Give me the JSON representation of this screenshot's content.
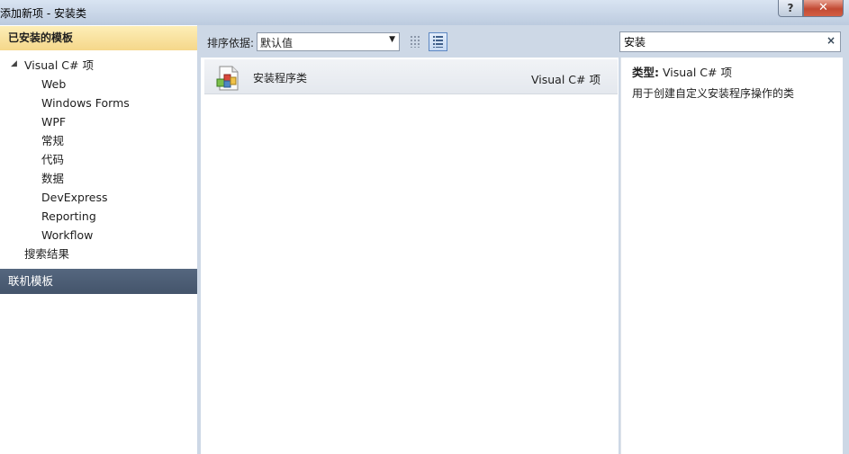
{
  "window": {
    "title": "添加新项 - 安装类",
    "help_label": "?",
    "close_label": "✕"
  },
  "left": {
    "installed_header": "已安装的模板",
    "tree": {
      "root_label": "Visual C# 项",
      "children": [
        "Web",
        "Windows Forms",
        "WPF",
        "常规",
        "代码",
        "数据",
        "DevExpress",
        "Reporting",
        "Workflow"
      ],
      "search_results": "搜索结果"
    },
    "online_header": "联机模板"
  },
  "toolbar": {
    "sort_label": "排序依据:",
    "sort_value": "默认值"
  },
  "search": {
    "value": "安装",
    "clear_label": "×"
  },
  "list": {
    "items": [
      {
        "name": "安装程序类",
        "type": "Visual C# 项"
      }
    ]
  },
  "details": {
    "type_label": "类型:",
    "type_value": "Visual C# 项",
    "description": "用于创建自定义安装程序操作的类"
  }
}
